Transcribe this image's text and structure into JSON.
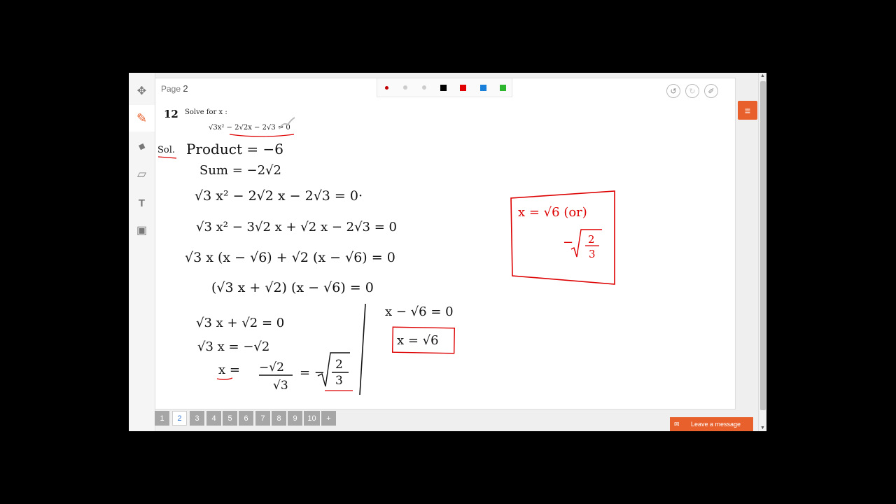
{
  "toolbar": {
    "tools": [
      {
        "name": "move-icon",
        "glyph": "✥"
      },
      {
        "name": "pencil-icon",
        "glyph": "✎"
      },
      {
        "name": "eraser-icon",
        "glyph": "◆"
      },
      {
        "name": "shapes-icon",
        "glyph": "▱"
      },
      {
        "name": "text-icon",
        "glyph": "T"
      },
      {
        "name": "image-icon",
        "glyph": "▣"
      }
    ]
  },
  "canvas": {
    "page_prefix": "Page",
    "page_number": "2",
    "palette": [
      "#c00000",
      "#cccccc",
      "#cccccc",
      "#000000",
      "#e00000",
      "#1a7fd8",
      "#2db52d"
    ],
    "question": {
      "number": "12",
      "prompt": "Solve for x :",
      "equation": "√3x² − 2√2x − 2√3 = 0"
    },
    "handwriting": {
      "sol": "Sol.",
      "line1": "Product = −6",
      "line2": "Sum = −2√2",
      "line3": "√3 x² − 2√2 x − 2√3 = 0·",
      "line4": "√3 x² − 3√2 x + √2 x − 2√3 = 0",
      "line5": "√3 x (x − √6) + √2 (x − √6) = 0",
      "line6": "(√3 x + √2) (x − √6) = 0",
      "left1": "√3 x + √2 = 0",
      "left2": "√3 x = −√2",
      "left3a": "x =",
      "left3b": "−√2",
      "left3c": "√3",
      "left3d": "= −",
      "left3e": "2",
      "left3f": "3",
      "right1": "x − √6 = 0",
      "right2": "x = √6",
      "box1": "x = √6  (or)",
      "box2": "−",
      "box3": "2",
      "box4": "3"
    }
  },
  "pagination": {
    "pages": [
      "1",
      "2",
      "3",
      "4",
      "5",
      "6",
      "7",
      "8",
      "9",
      "10",
      "+"
    ],
    "active": "2"
  },
  "menu_glyph": "≡",
  "leave_message": "Leave a message",
  "accent_color": "#e8612c"
}
